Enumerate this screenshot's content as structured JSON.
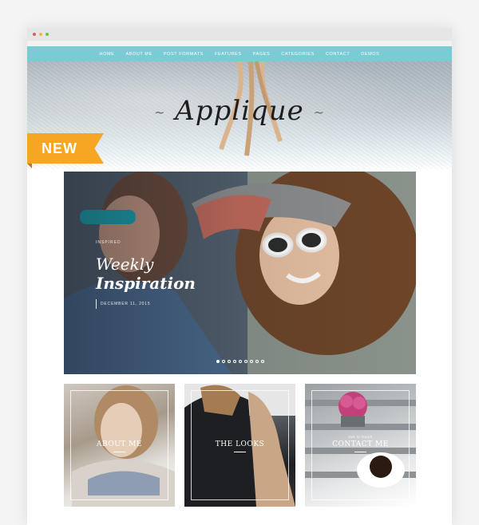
{
  "nav": {
    "items": [
      "HOME",
      "ABOUT ME",
      "POST FORMATS",
      "FEATURES",
      "PAGES",
      "CATEGORIES",
      "CONTACT",
      "DEMOS"
    ]
  },
  "header": {
    "logo": "Applique",
    "ribbon_label": "NEW"
  },
  "slider": {
    "category": "INSPIRED",
    "title_line1": "Weekly",
    "title_line2": "Inspiration",
    "date": "DECEMBER 11, 2015",
    "slide_count": 9,
    "active_slide": 1
  },
  "tiles": [
    {
      "subtitle": "",
      "label": "ABOUT ME"
    },
    {
      "subtitle": "",
      "label": "THE LOOKS"
    },
    {
      "subtitle": "Get In Touch",
      "label": "CONTACT ME"
    }
  ],
  "colors": {
    "nav_bg": "#79ccd3",
    "ribbon": "#f6a623",
    "accent": "#ffffff"
  }
}
